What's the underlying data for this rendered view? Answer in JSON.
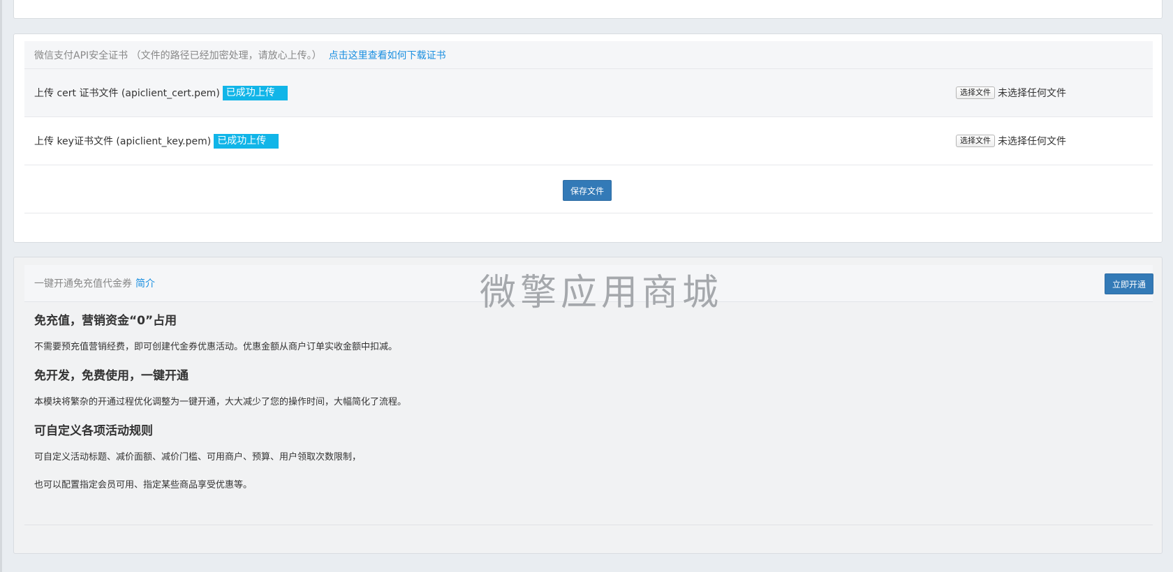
{
  "cert_section": {
    "header_text": "微信支付API安全证书 （文件的路径已经加密处理，请放心上传。）",
    "header_link": "点击这里查看如何下载证书",
    "rows": [
      {
        "label": "上传 cert 证书文件 (apiclient_cert.pem)",
        "status": "已成功上传",
        "choose_button": "选择文件",
        "file_status": "未选择任何文件"
      },
      {
        "label": "上传 key证书文件 (apiclient_key.pem)",
        "status": "已成功上传",
        "choose_button": "选择文件",
        "file_status": "未选择任何文件"
      }
    ],
    "save_button": "保存文件"
  },
  "coupon_section": {
    "header_text": "一键开通免充值代金券",
    "header_link": "简介",
    "watermark": "微擎应用商城",
    "open_button": "立即开通",
    "features": [
      {
        "title": "免充值，营销资金“0”占用",
        "lines": [
          "不需要预充值营销经费，即可创建代金券优惠活动。优惠金额从商户订单实收金额中扣减。"
        ]
      },
      {
        "title": "免开发，免费使用，一键开通",
        "lines": [
          "本模块将繁杂的开通过程优化调整为一键开通，大大减少了您的操作时间，大幅简化了流程。"
        ]
      },
      {
        "title": "可自定义各项活动规则",
        "lines": [
          "可自定义活动标题、减价面额、减价门槛、可用商户、预算、用户领取次数限制，",
          "也可以配置指定会员可用、指定某些商品享受优惠等。"
        ]
      }
    ]
  },
  "colors": {
    "primary": "#337ab7",
    "badge": "#11b5e8",
    "link": "#1a8fe0",
    "page_bg": "#e9edf1"
  }
}
